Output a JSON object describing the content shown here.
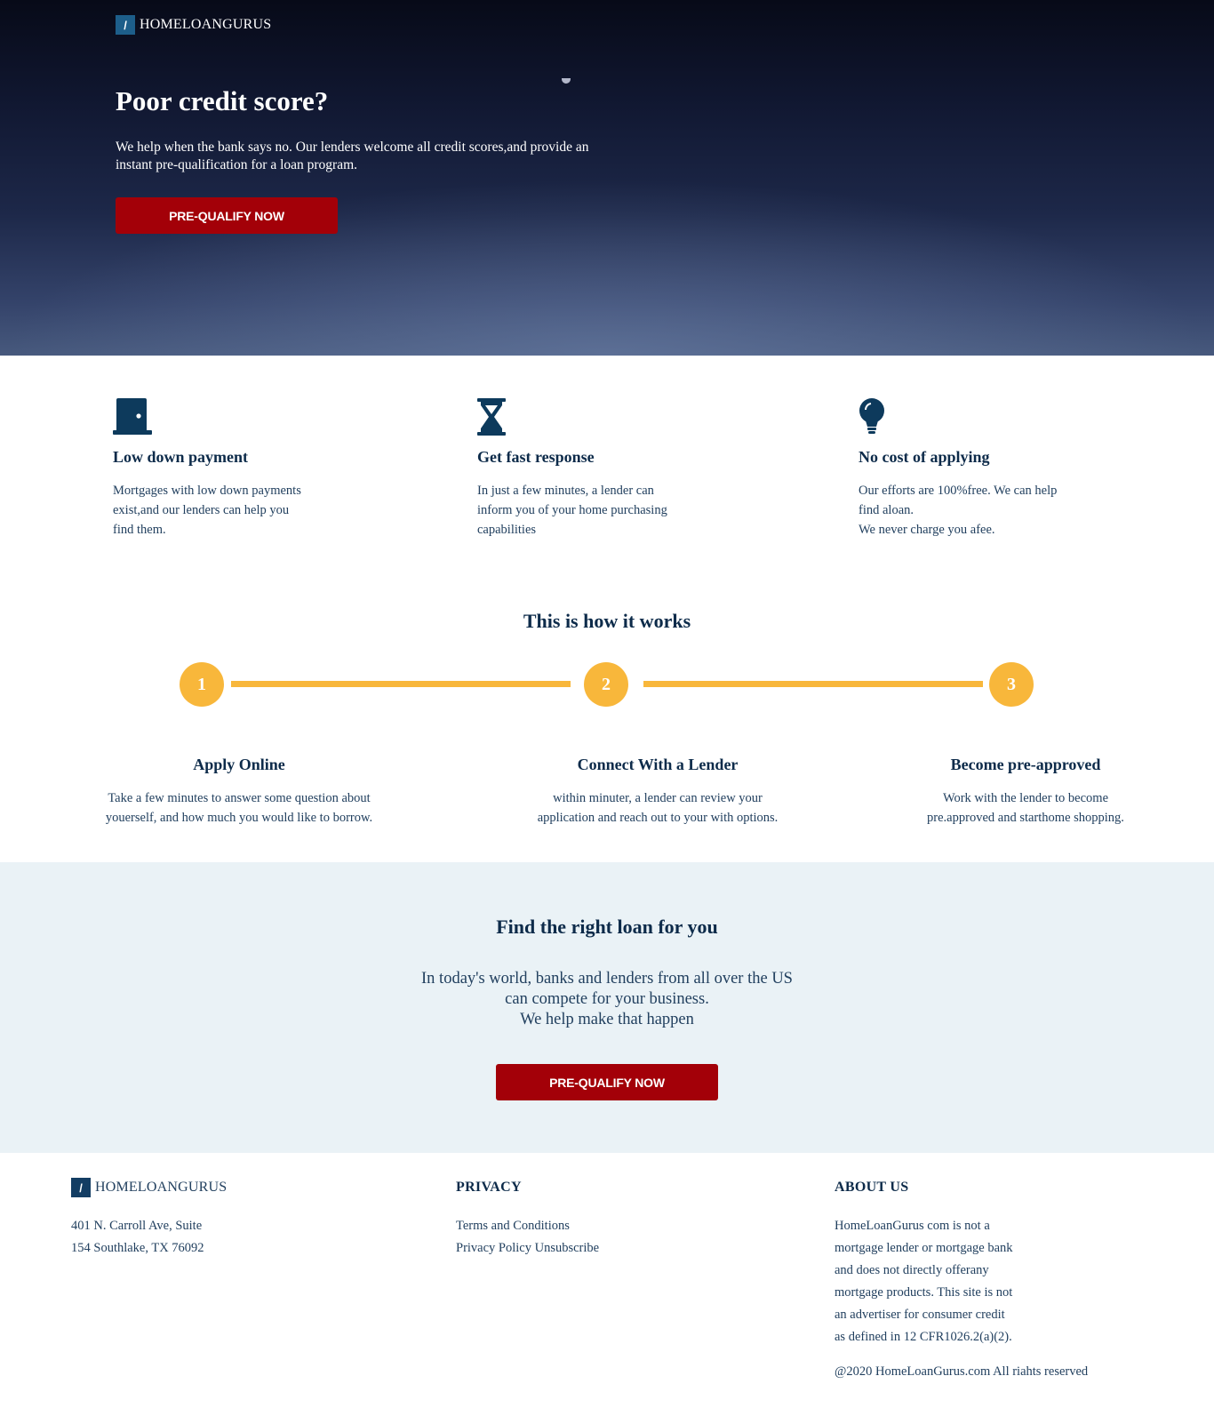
{
  "hero": {
    "brand_mark": "/",
    "brand_name": "HOMELOANGURUS",
    "title": "Poor credit score?",
    "text": "We help when the bank says no. Our lenders welcome all credit scores,and provide an instant pre-qualification for a loan program.",
    "cta": "PRE-QUALIFY NOW"
  },
  "features": [
    {
      "icon": "door-icon",
      "title": "Low down payment",
      "text": "Mortgages with low down payments\nexist,and our lenders can help you\nfind them."
    },
    {
      "icon": "hourglass-icon",
      "title": "Get fast response",
      "text": "In just a few minutes, a lender can\ninform you of your home purchasing\ncapabilities"
    },
    {
      "icon": "lightbulb-icon",
      "title": "No cost of applying",
      "text": "Our efforts are 100%free. We can help\nfind aloan.\nWe never charge you afee."
    }
  ],
  "how": {
    "title": "This is how it works",
    "steps": [
      {
        "number": "1",
        "title": "Apply Online",
        "text": "Take a few minutes to answer some question about\nyouerself, and how much you would like to borrow."
      },
      {
        "number": "2",
        "title": "Connect With a Lender",
        "text": "within minuter, a lender can review your\napplication and reach out to your with options."
      },
      {
        "number": "3",
        "title": "Become pre-approved",
        "text": "Work with the lender to become\npre.approved and starthome shopping."
      }
    ]
  },
  "find": {
    "title": "Find the right loan for you",
    "text": "In today's world, banks and lenders from all over the US\ncan compete for your business.\nWe help make that happen",
    "cta": "PRE-QUALIFY NOW"
  },
  "footer": {
    "brand_mark": "/",
    "brand_name": "HOMELOANGURUS",
    "address_line1": "401 N. Carroll Ave, Suite",
    "address_line2": "154 Southlake, TX 76092",
    "privacy_title": "PRIVACY",
    "links": [
      "Terms and Conditions",
      "Privacy Policy Unsubscribe"
    ],
    "about_title": "ABOUT US",
    "about_lines": [
      "HomeLoanGurus com is not a",
      "mortgage lender or mortgage bank",
      "and does not directly offerany",
      "mortgage products. This site is not",
      "an advertiser for consumer credit",
      "as defined in 12 CFR1026.2(a)(2)."
    ],
    "copyright": "@2020 HomeLoanGurus.com All riahts reserved"
  },
  "colors": {
    "navy": "#0d2b4a",
    "cta_red": "#a30008",
    "step_yellow": "#f8b73b",
    "light_section": "#eaf2f6"
  }
}
